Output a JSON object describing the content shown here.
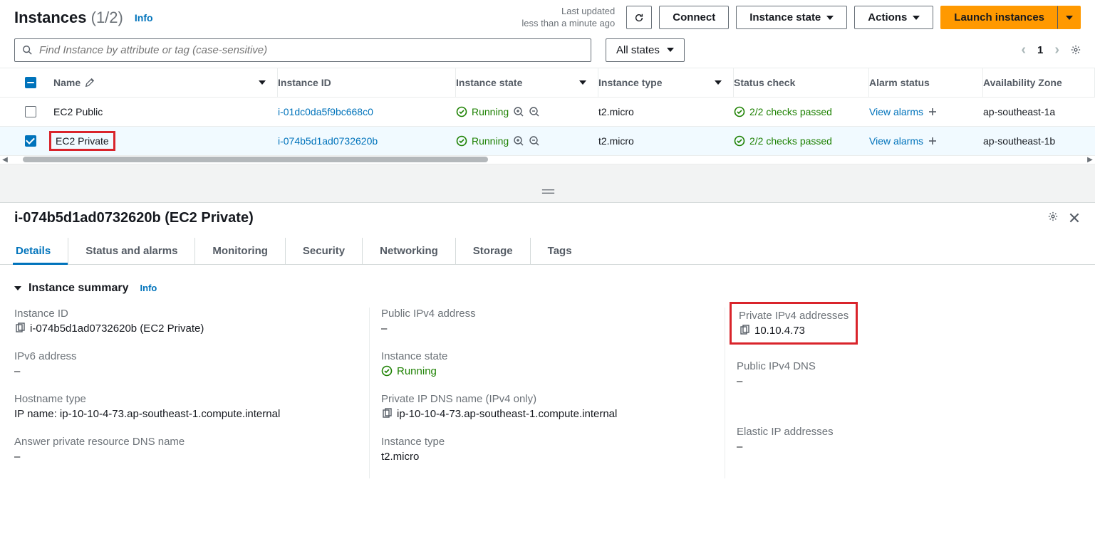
{
  "header": {
    "title": "Instances",
    "count": "(1/2)",
    "info": "Info",
    "last_updated_label": "Last updated",
    "last_updated_time": "less than a minute ago",
    "connect": "Connect",
    "instance_state": "Instance state",
    "actions": "Actions",
    "launch": "Launch instances"
  },
  "filter": {
    "placeholder": "Find Instance by attribute or tag (case-sensitive)",
    "states": "All states",
    "page": "1"
  },
  "columns": {
    "name": "Name",
    "instance_id": "Instance ID",
    "instance_state": "Instance state",
    "instance_type": "Instance type",
    "status_check": "Status check",
    "alarm_status": "Alarm status",
    "az": "Availability Zone"
  },
  "rows": [
    {
      "selected": false,
      "name": "EC2 Public",
      "id": "i-01dc0da5f9bc668c0",
      "state": "Running",
      "type": "t2.micro",
      "status": "2/2 checks passed",
      "alarm": "View alarms",
      "az": "ap-southeast-1a",
      "highlight": false
    },
    {
      "selected": true,
      "name": "EC2 Private",
      "id": "i-074b5d1ad0732620b",
      "state": "Running",
      "type": "t2.micro",
      "status": "2/2 checks passed",
      "alarm": "View alarms",
      "az": "ap-southeast-1b",
      "highlight": true
    }
  ],
  "detail": {
    "title": "i-074b5d1ad0732620b (EC2 Private)",
    "tabs": [
      "Details",
      "Status and alarms",
      "Monitoring",
      "Security",
      "Networking",
      "Storage",
      "Tags"
    ],
    "active_tab": 0,
    "summary_title": "Instance summary",
    "summary_info": "Info",
    "fields": {
      "instance_id_label": "Instance ID",
      "instance_id_value": "i-074b5d1ad0732620b (EC2 Private)",
      "ipv6_label": "IPv6 address",
      "ipv6_value": "–",
      "hostname_type_label": "Hostname type",
      "hostname_type_value": "IP name: ip-10-10-4-73.ap-southeast-1.compute.internal",
      "answer_dns_label": "Answer private resource DNS name",
      "answer_dns_value": "–",
      "public_ipv4_label": "Public IPv4 address",
      "public_ipv4_value": "–",
      "instance_state_label": "Instance state",
      "instance_state_value": "Running",
      "private_dns_label": "Private IP DNS name (IPv4 only)",
      "private_dns_value": "ip-10-10-4-73.ap-southeast-1.compute.internal",
      "instance_type_label": "Instance type",
      "instance_type_value": "t2.micro",
      "private_ipv4_label": "Private IPv4 addresses",
      "private_ipv4_value": "10.10.4.73",
      "public_dns_label": "Public IPv4 DNS",
      "public_dns_value": "–",
      "elastic_ip_label": "Elastic IP addresses",
      "elastic_ip_value": "–"
    }
  }
}
